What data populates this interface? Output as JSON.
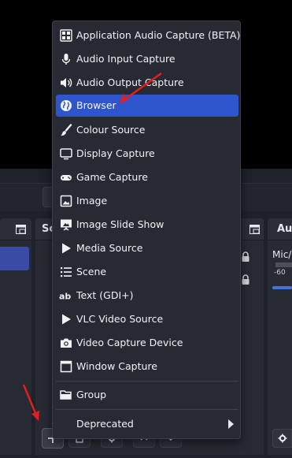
{
  "panels": {
    "scenes_title": "Sc",
    "sources_title": "So",
    "mixer_title": "Au"
  },
  "mixer": {
    "channel_label": "Mic/",
    "db_label": "-60"
  },
  "menu": {
    "items": [
      {
        "label": "Application Audio Capture (BETA)",
        "icon": "application-audio-icon"
      },
      {
        "label": "Audio Input Capture",
        "icon": "microphone-icon"
      },
      {
        "label": "Audio Output Capture",
        "icon": "speaker-icon"
      },
      {
        "label": "Browser",
        "icon": "globe-icon"
      },
      {
        "label": "Colour Source",
        "icon": "paintbrush-icon"
      },
      {
        "label": "Display Capture",
        "icon": "monitor-icon"
      },
      {
        "label": "Game Capture",
        "icon": "gamepad-icon"
      },
      {
        "label": "Image",
        "icon": "image-icon"
      },
      {
        "label": "Image Slide Show",
        "icon": "slideshow-icon"
      },
      {
        "label": "Media Source",
        "icon": "play-icon"
      },
      {
        "label": "Scene",
        "icon": "list-icon"
      },
      {
        "label": "Text (GDI+)",
        "icon": "text-icon"
      },
      {
        "label": "VLC Video Source",
        "icon": "vlc-play-icon"
      },
      {
        "label": "Video Capture Device",
        "icon": "camera-icon"
      },
      {
        "label": "Window Capture",
        "icon": "window-icon"
      }
    ],
    "group_label": "Group",
    "deprecated_label": "Deprecated",
    "highlighted_item": "Browser"
  },
  "colors": {
    "accent": "#2f55cc",
    "annotation_arrow": "#e02020"
  }
}
